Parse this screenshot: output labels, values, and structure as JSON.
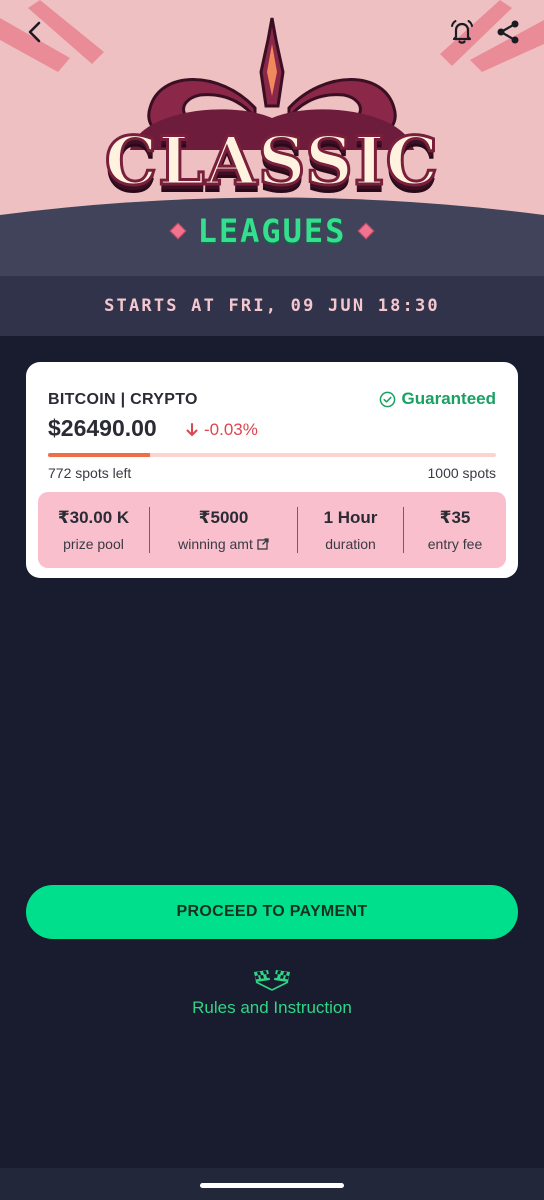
{
  "header": {
    "title_main": "CLASSIC",
    "title_sub": "LEAGUES",
    "starts_text": "STARTS AT FRI, 09 JUN 18:30",
    "icons": [
      "back-arrow-icon",
      "bell-icon",
      "share-icon"
    ]
  },
  "contest": {
    "market": "BITCOIN | CRYPTO",
    "guaranteed_label": "Guaranteed",
    "price": "$26490.00",
    "change": "-0.03%",
    "spots_left": "772 spots left",
    "spots_total": "1000 spots",
    "fill_fraction": 0.228,
    "stats": [
      {
        "value": "₹30.00 K",
        "label": "prize pool"
      },
      {
        "value": "₹5000",
        "label": "winning amt"
      },
      {
        "value": "1 Hour",
        "label": "duration"
      },
      {
        "value": "₹35",
        "label": "entry fee"
      }
    ]
  },
  "actions": {
    "proceed_label": "PROCEED TO PAYMENT",
    "rules_label": "Rules and Instruction"
  },
  "colors": {
    "background": "#181c2e",
    "accent_green": "#00df8b",
    "guaranteed_green": "#1aa062",
    "negative_red": "#e0444f",
    "stats_pink": "#f9bfcd",
    "progress_orange": "#ee6e47"
  }
}
